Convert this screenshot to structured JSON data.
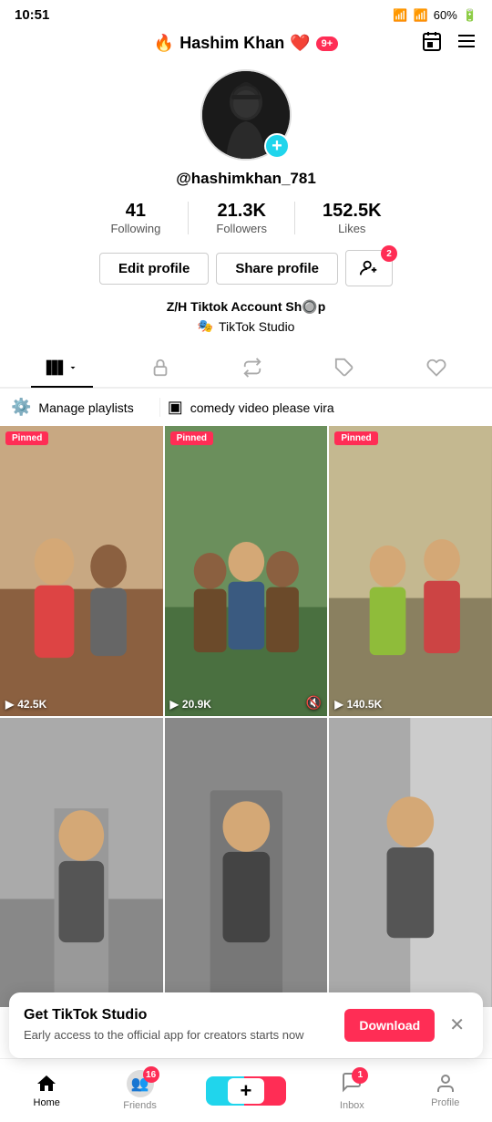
{
  "statusBar": {
    "time": "10:51",
    "battery": "60%"
  },
  "topNav": {
    "title": "Hashim Khan",
    "fireEmoji": "🔥",
    "heartEmoji": "❤️",
    "notificationCount": "9+",
    "calendarIcon": "📅",
    "menuIcon": "☰"
  },
  "profile": {
    "username": "@hashimkhan_781",
    "addIcon": "+",
    "stats": {
      "following": {
        "value": "41",
        "label": "Following"
      },
      "followers": {
        "value": "21.3K",
        "label": "Followers"
      },
      "likes": {
        "value": "152.5K",
        "label": "Likes"
      }
    },
    "editProfileLabel": "Edit profile",
    "shareProfileLabel": "Share profile",
    "followIcon": "👤",
    "followBadge": "2",
    "bio1": "Z/H Tiktok Account Sh🔘p",
    "bio2": "TikTok Studio",
    "bio2Icon": "🎭"
  },
  "tabs": [
    {
      "id": "videos",
      "icon": "▪",
      "active": true
    },
    {
      "id": "lock",
      "icon": "🔒",
      "active": false
    },
    {
      "id": "repost",
      "icon": "🔁",
      "active": false
    },
    {
      "id": "tag",
      "icon": "🏷",
      "active": false
    },
    {
      "id": "heart",
      "icon": "♡",
      "active": false
    }
  ],
  "playlists": [
    {
      "icon": "⚙",
      "label": "Manage playlists"
    },
    {
      "icon": "▣",
      "label": "comedy video please vira"
    }
  ],
  "videos": [
    {
      "pinned": true,
      "views": "42.5K",
      "hasMute": false,
      "bgClass": "thumb-1"
    },
    {
      "pinned": true,
      "views": "20.9K",
      "hasMute": true,
      "bgClass": "thumb-2"
    },
    {
      "pinned": true,
      "views": "140.5K",
      "hasMute": false,
      "bgClass": "thumb-3"
    },
    {
      "pinned": false,
      "views": "",
      "hasMute": false,
      "bgClass": "thumb-4"
    },
    {
      "pinned": false,
      "views": "",
      "hasMute": false,
      "bgClass": "thumb-5"
    },
    {
      "pinned": false,
      "views": "",
      "hasMute": false,
      "bgClass": "thumb-6"
    }
  ],
  "banner": {
    "title": "Get TikTok Studio",
    "subtitle": "Early access to the official app for creators starts now",
    "downloadLabel": "Download",
    "closeIcon": "✕"
  },
  "bottomNav": {
    "home": {
      "label": "Home",
      "icon": "🏠"
    },
    "friends": {
      "label": "Friends",
      "badge": "16"
    },
    "plus": {
      "label": ""
    },
    "inbox": {
      "label": "Inbox",
      "badge": "1"
    },
    "profile": {
      "label": "Profile"
    }
  }
}
